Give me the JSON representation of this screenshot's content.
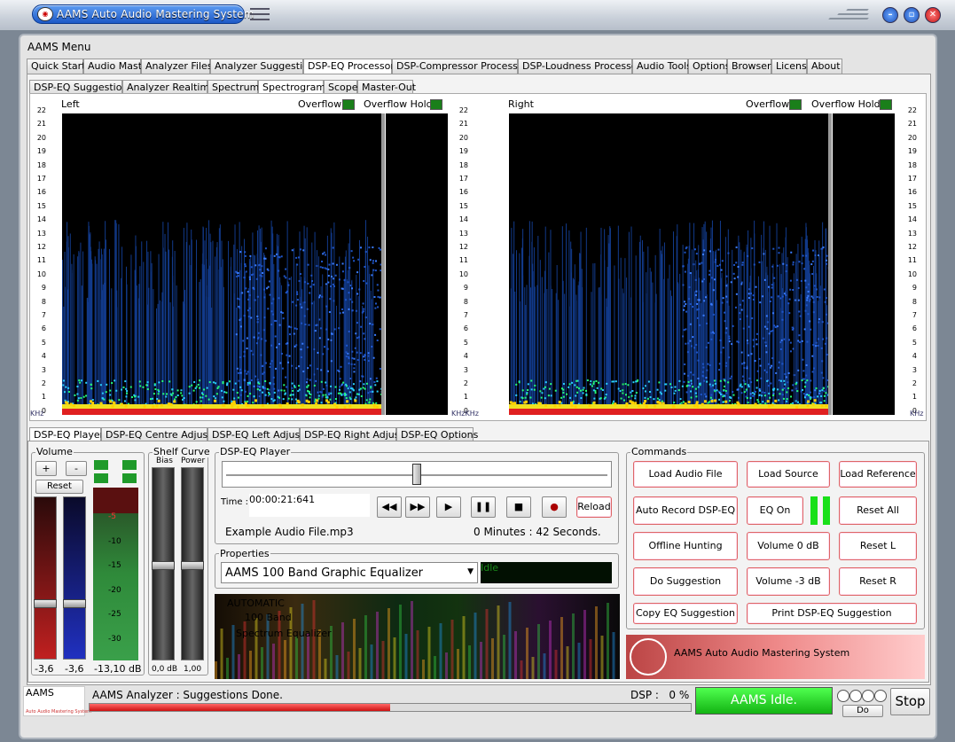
{
  "window": {
    "title": "AAMS Auto Audio Mastering System",
    "logo_text": "AAMS"
  },
  "menu_label": "AAMS Menu",
  "main_tabs": [
    "Quick Start",
    "Audio Master",
    "Analyzer Files",
    "Analyzer Suggestion",
    "DSP-EQ Processor",
    "DSP-Compressor Processor",
    "DSP-Loudness Processor",
    "Audio Tools",
    "Options",
    "Browser",
    "License",
    "About"
  ],
  "main_tab_active": "DSP-EQ Processor",
  "sub_tabs": [
    "DSP-EQ Suggestion",
    "Analyzer Realtime",
    "Spectrum",
    "Spectrogram",
    "Scope",
    "Master-Out"
  ],
  "sub_tab_active": "Spectrogram",
  "spectrogram": {
    "left_label": "Left",
    "right_label": "Right",
    "overflow": "Overflow",
    "overflow_hold": "Overflow Hold",
    "khz_unit": "KHz",
    "khz_unit_joined": "KHzKHz",
    "ticks": [
      "22",
      "21",
      "20",
      "19",
      "18",
      "17",
      "16",
      "15",
      "14",
      "13",
      "12",
      "11",
      "10",
      "9",
      "8",
      "7",
      "6",
      "5",
      "4",
      "3",
      "2",
      "1",
      "0"
    ]
  },
  "lower_tabs": [
    "DSP-EQ Player",
    "DSP-EQ Centre Adjust",
    "DSP-EQ Left Adjust",
    "DSP-EQ Right Adjust",
    "DSP-EQ Options"
  ],
  "lower_tab_active": "DSP-EQ Player",
  "volume": {
    "label": "Volume",
    "plus": "+",
    "minus": "-",
    "reset": "Reset",
    "left_value": "-3,6",
    "right_value": "-3,6",
    "meter_value": "-13,10 dB",
    "scale": [
      "-5",
      "-10",
      "-15",
      "-20",
      "-25",
      "-30"
    ]
  },
  "shelf": {
    "label": "Shelf Curve",
    "bias": "Bias",
    "power": "Power",
    "bias_value": "0,0 dB",
    "power_value": "1,00"
  },
  "player": {
    "label": "DSP-EQ Player",
    "time_label": "Time :",
    "time_display": "00:00:21:641",
    "reload": "Reload",
    "file_name": "Example Audio File.mp3",
    "duration": "0 Minutes : 42 Seconds.",
    "position_fraction": 0.5
  },
  "properties": {
    "label": "Properties",
    "selected": "AAMS 100 Band Graphic Equalizer",
    "status_lcd": "Idle"
  },
  "banner": {
    "line1": "AUTOMATIC",
    "line2": "100 Band",
    "line3": "Spectrum Equalizer"
  },
  "commands": {
    "label": "Commands",
    "load_audio_file": "Load Audio File",
    "load_source": "Load Source",
    "load_reference": "Load Reference",
    "auto_record": "Auto Record DSP-EQ",
    "eq_on": "EQ On",
    "reset_all": "Reset All",
    "offline_hunting": "Offline Hunting",
    "volume_0": "Volume 0 dB",
    "reset_l": "Reset L",
    "do_suggestion": "Do Suggestion",
    "volume_3": "Volume -3 dB",
    "reset_r": "Reset R",
    "copy_eq": "Copy EQ Suggestion",
    "print_eq": "Print DSP-EQ Suggestion"
  },
  "aams_banner": "AAMS Auto Audio Mastering System",
  "status": {
    "logo": "AAMS",
    "logo_sub": "Auto Audio Mastering System",
    "message": "AAMS Analyzer : Suggestions Done.",
    "dsp": "DSP :   0 %",
    "idle": "AAMS Idle.",
    "do": "Do",
    "stop": "Stop",
    "progress_fraction": 0.5
  }
}
